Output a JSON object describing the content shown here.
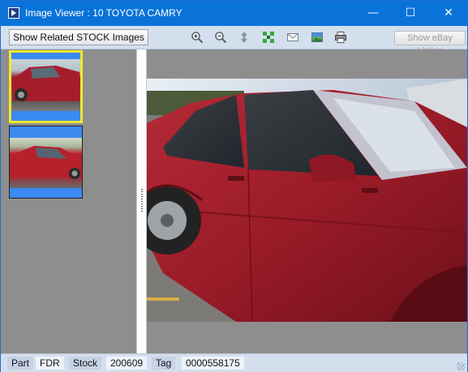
{
  "window": {
    "title": "Image Viewer : 10 TOYOTA CAMRY",
    "minimize": "—",
    "maximize": "☐",
    "close": "✕"
  },
  "toolbar": {
    "related_label": "Show Related STOCK Images",
    "ebay_label": "Show eBay Listing",
    "icons": [
      "zoom-in-icon",
      "zoom-out-icon",
      "fit-vertical-icon",
      "fit-all-icon",
      "email-icon",
      "image-icon",
      "print-icon"
    ]
  },
  "thumbnails": {
    "count": 2,
    "selected_index": 0
  },
  "status": {
    "part_label": "Part",
    "fdr_label": "FDR",
    "stock_label": "Stock",
    "stock_value": "200609",
    "tag_label": "Tag",
    "tag_value": "0000558175"
  },
  "colors": {
    "titlebar": "#0a73d9",
    "selected_border": "#f0e92c",
    "car_red": "#a01e2c"
  }
}
